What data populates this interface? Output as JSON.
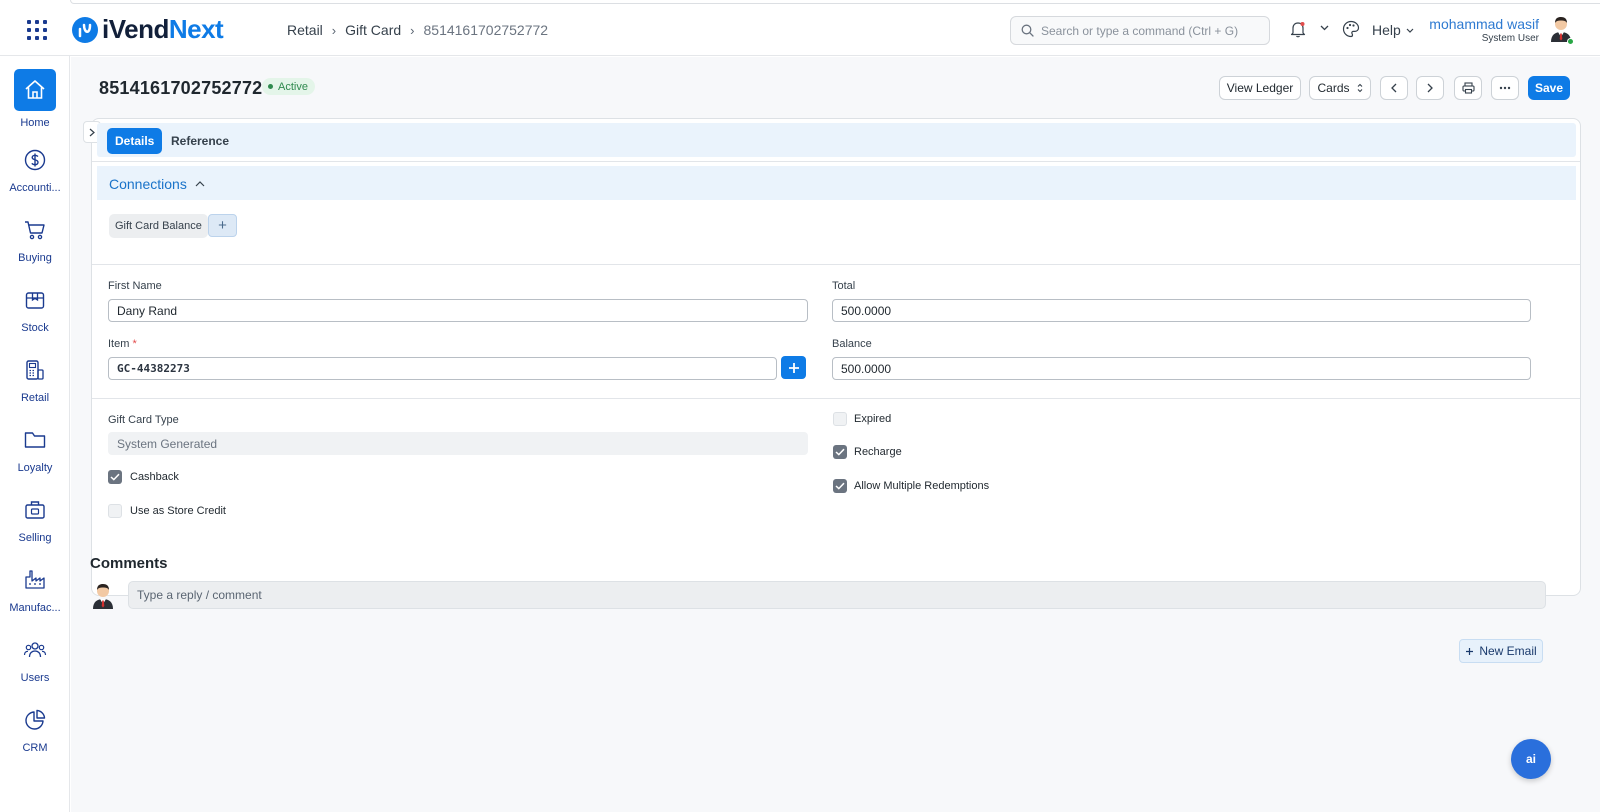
{
  "header": {
    "brand": {
      "part1": "iVend",
      "part2": "Next"
    },
    "breadcrumb": [
      "Retail",
      "Gift Card",
      "8514161702752772"
    ],
    "search_placeholder": "Search or type a command (Ctrl + G)",
    "help_label": "Help",
    "user": {
      "name": "mohammad wasif",
      "role": "System User"
    }
  },
  "sidebar": {
    "items": [
      {
        "label": "Home",
        "icon": "home-icon",
        "active": true
      },
      {
        "label": "Accounti...",
        "icon": "dollar-circle-icon"
      },
      {
        "label": "Buying",
        "icon": "cart-icon"
      },
      {
        "label": "Stock",
        "icon": "box-icon"
      },
      {
        "label": "Retail",
        "icon": "pos-terminal-icon"
      },
      {
        "label": "Loyalty",
        "icon": "folder-icon"
      },
      {
        "label": "Selling",
        "icon": "briefcase-icon"
      },
      {
        "label": "Manufac...",
        "icon": "factory-icon"
      },
      {
        "label": "Users",
        "icon": "users-icon"
      },
      {
        "label": "CRM",
        "icon": "pie-chart-icon"
      }
    ]
  },
  "document": {
    "title": "8514161702752772",
    "status": "Active",
    "status_color": "#2f8a4e",
    "toolbar": {
      "view_ledger": "View Ledger",
      "cards": "Cards",
      "save": "Save"
    },
    "tabs": [
      {
        "label": "Details",
        "active": true
      },
      {
        "label": "Reference",
        "active": false
      }
    ],
    "connections": {
      "title": "Connections",
      "chip": "Gift Card Balance",
      "add_symbol": "+"
    },
    "fields": {
      "first_name": {
        "label": "First Name",
        "value": "Dany Rand"
      },
      "total": {
        "label": "Total",
        "value": "500.0000"
      },
      "item": {
        "label": "Item",
        "required_mark": "*",
        "value": "GC-44382273"
      },
      "balance": {
        "label": "Balance",
        "value": "500.0000"
      },
      "gift_card_type": {
        "label": "Gift Card Type",
        "value": "System Generated"
      }
    },
    "checkboxes": {
      "cashback": {
        "label": "Cashback",
        "checked": true
      },
      "use_as_store_credit": {
        "label": "Use as Store Credit",
        "checked": false
      },
      "expired": {
        "label": "Expired",
        "checked": false
      },
      "recharge": {
        "label": "Recharge",
        "checked": true
      },
      "allow_multiple_redemptions": {
        "label": "Allow Multiple Redemptions",
        "checked": true
      }
    }
  },
  "comments": {
    "title": "Comments",
    "placeholder": "Type a reply / comment"
  },
  "new_email_label": "New Email",
  "ai_label": "ai",
  "colors": {
    "accent": "#0e7be6",
    "brand_dark": "#12203a",
    "nav": "#1a3a8f"
  }
}
